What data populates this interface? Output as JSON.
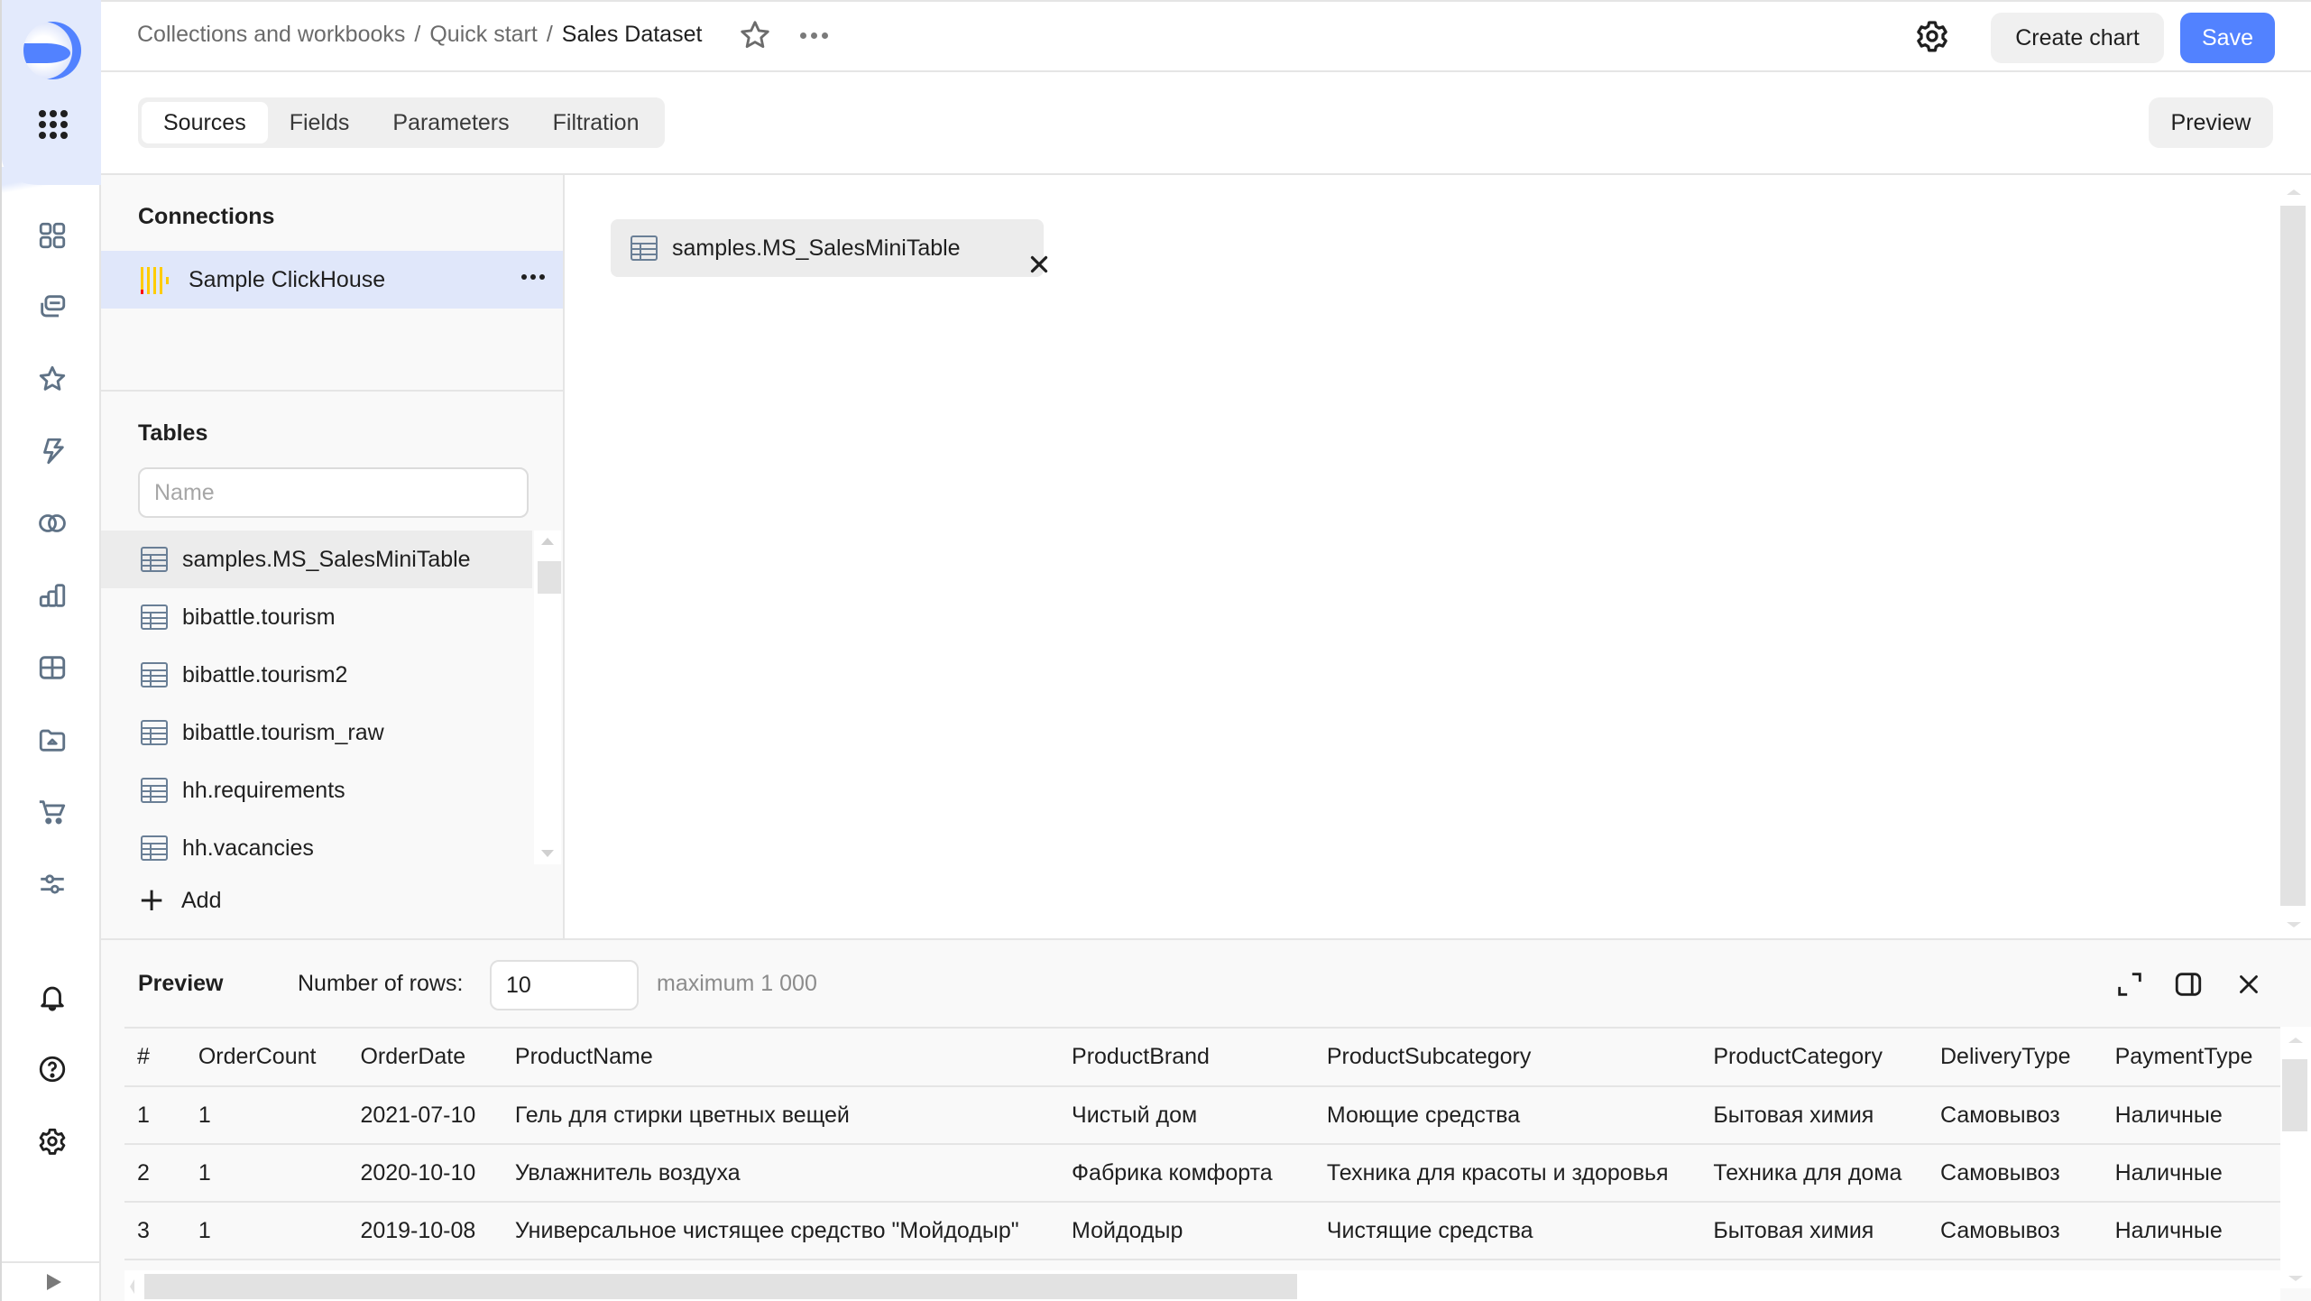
{
  "header": {
    "breadcrumb": [
      {
        "label": "Collections and workbooks"
      },
      {
        "label": "Quick start"
      },
      {
        "label": "Sales Dataset"
      }
    ],
    "separator": "/",
    "create_chart_label": "Create chart",
    "save_label": "Save"
  },
  "nav": {
    "items": [
      {
        "icon": "dashboard-grid-icon"
      },
      {
        "icon": "collections-icon"
      },
      {
        "icon": "favorites-star-icon"
      },
      {
        "icon": "lightning-icon"
      },
      {
        "icon": "connections-rings-icon"
      },
      {
        "icon": "charts-bar-icon"
      },
      {
        "icon": "datasets-grid-icon"
      },
      {
        "icon": "workbook-folder-icon"
      },
      {
        "icon": "marketplace-cart-icon"
      },
      {
        "icon": "settings-sliders-icon"
      }
    ],
    "bottom": [
      {
        "icon": "bell-icon"
      },
      {
        "icon": "help-icon"
      },
      {
        "icon": "gear-icon"
      }
    ]
  },
  "tabs": [
    {
      "label": "Sources",
      "active": true
    },
    {
      "label": "Fields",
      "active": false
    },
    {
      "label": "Parameters",
      "active": false
    },
    {
      "label": "Filtration",
      "active": false
    }
  ],
  "preview_button_label": "Preview",
  "connections": {
    "title": "Connections",
    "items": [
      {
        "label": "Sample ClickHouse",
        "selected": true
      }
    ]
  },
  "tables": {
    "title": "Tables",
    "search_placeholder": "Name",
    "search_value": "",
    "items": [
      {
        "label": "samples.MS_SalesMiniTable",
        "active": true
      },
      {
        "label": "bibattle.tourism",
        "active": false
      },
      {
        "label": "bibattle.tourism2",
        "active": false
      },
      {
        "label": "bibattle.tourism_raw",
        "active": false
      },
      {
        "label": "hh.requirements",
        "active": false
      },
      {
        "label": "hh.vacancies",
        "active": false
      }
    ],
    "add_label": "Add"
  },
  "canvas": {
    "sources": [
      {
        "label": "samples.MS_SalesMiniTable"
      }
    ]
  },
  "preview": {
    "title": "Preview",
    "rows_label": "Number of rows:",
    "rows_value": "10",
    "max_label": "maximum 1 000",
    "columns": [
      "#",
      "OrderCount",
      "OrderDate",
      "ProductName",
      "ProductBrand",
      "ProductSubcategory",
      "ProductCategory",
      "DeliveryType",
      "PaymentType"
    ],
    "rows": [
      [
        "1",
        "1",
        "2021-07-10",
        "Гель для стирки цветных вещей",
        "Чистый дом",
        "Моющие средства",
        "Бытовая химия",
        "Самовывоз",
        "Наличные"
      ],
      [
        "2",
        "1",
        "2020-10-10",
        "Увлажнитель воздуха",
        "Фабрика комфорта",
        "Техника для красоты и здоровья",
        "Техника для дома",
        "Самовывоз",
        "Наличные"
      ],
      [
        "3",
        "1",
        "2019-10-08",
        "Универсальное чистящее средство \"Мойдодыр\"",
        "Мойдодыр",
        "Чистящие средства",
        "Бытовая химия",
        "Самовывоз",
        "Наличные"
      ]
    ]
  },
  "colors": {
    "accent": "#5282ff",
    "nav_top_bg": "#e3eafc",
    "selected_row_bg": "#e0e7fa",
    "clickhouse_yellow": "#ffcc00",
    "clickhouse_red": "#ff0000"
  }
}
